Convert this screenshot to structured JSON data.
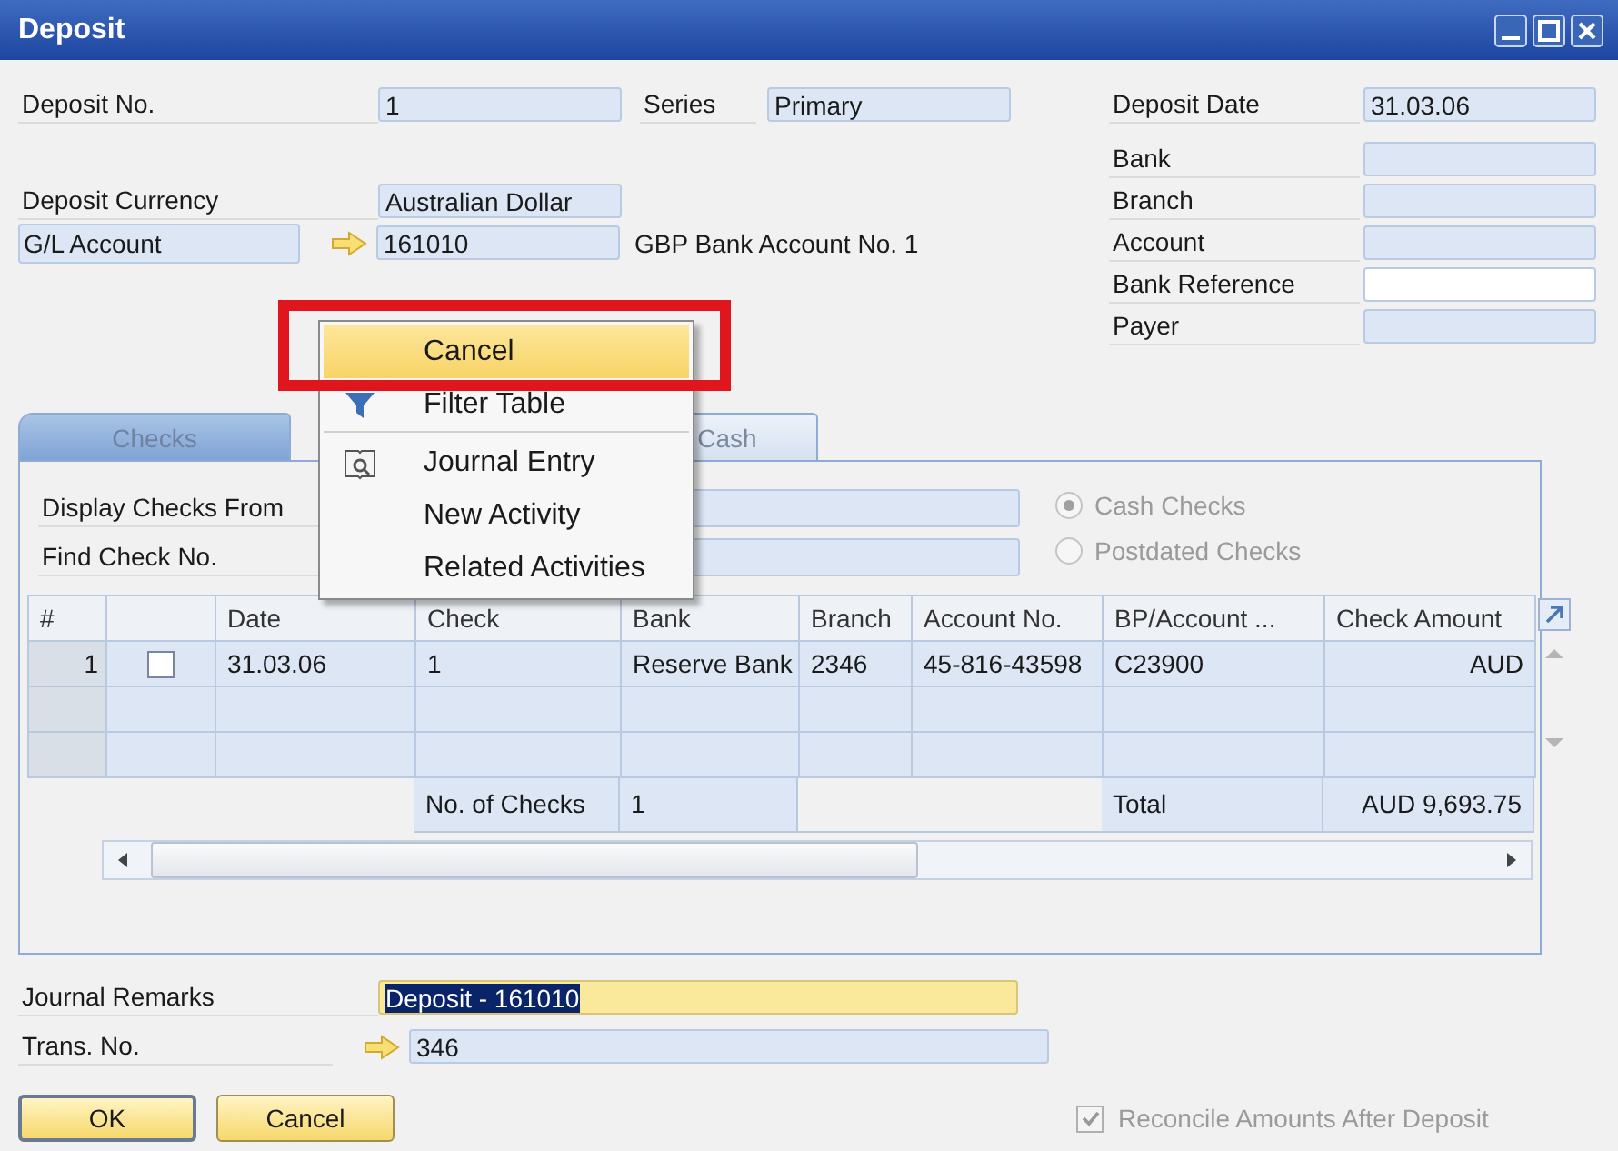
{
  "window": {
    "title": "Deposit"
  },
  "header": {
    "left": [
      {
        "label": "Deposit No.",
        "value": "1",
        "second_label": "Series",
        "second_value": "Primary"
      },
      {
        "label": "Deposit Currency",
        "value": "Australian Dollar"
      },
      {
        "label": "G/L Account",
        "kind": "linked",
        "value": "161010",
        "note": "GBP Bank Account No. 1"
      }
    ],
    "right": [
      {
        "label": "Deposit Date",
        "value": "31.03.06",
        "editable": false
      },
      {
        "label": "Bank",
        "editable": false
      },
      {
        "label": "Branch",
        "editable": false
      },
      {
        "label": "Account",
        "editable": false
      },
      {
        "label": "Bank Reference",
        "editable": true
      },
      {
        "label": "Payer",
        "editable": false
      }
    ]
  },
  "tabs": [
    {
      "label": "Checks",
      "selected": true
    },
    {
      "label": "Cash",
      "selected": false
    }
  ],
  "filters": [
    {
      "label": "Display Checks From"
    },
    {
      "label": "Find Check No."
    }
  ],
  "radios": [
    {
      "label": "Cash Checks",
      "selected": true,
      "disabled": true
    },
    {
      "label": "Postdated Checks",
      "selected": false,
      "disabled": true
    }
  ],
  "table": {
    "columns": [
      "#",
      "",
      "Date",
      "Check",
      "Bank",
      "Branch",
      "Account No.",
      "BP/Account ...",
      "Check Amount"
    ],
    "rows": [
      {
        "cells": [
          "1",
          {
            "kind": "checkbox",
            "checked": false
          },
          "31.03.06",
          "1",
          "Reserve Bank",
          "2346",
          "45-816-43598",
          "C23900",
          "AUD"
        ]
      }
    ],
    "footer": {
      "count_label": "No. of Checks",
      "count": "1",
      "total_label": "Total",
      "total": "AUD 9,693.75"
    }
  },
  "journal_remarks": {
    "label": "Journal Remarks",
    "value": "Deposit - 161010",
    "selected": true
  },
  "trans_no": {
    "label": "Trans. No.",
    "value": "346"
  },
  "buttons": [
    {
      "label": "OK",
      "default": true
    },
    {
      "label": "Cancel",
      "default": false
    }
  ],
  "reconcile": {
    "label": "Reconcile Amounts After Deposit",
    "checked": true,
    "disabled": true
  },
  "context_menu": {
    "items": [
      {
        "label": "Cancel",
        "kind": "text",
        "highlighted": true,
        "separator_after": false
      },
      {
        "label": "Filter Table",
        "kind": "filter",
        "highlighted": false,
        "separator_after": true
      },
      {
        "label": "Journal Entry",
        "kind": "journal",
        "highlighted": false,
        "separator_after": false
      },
      {
        "label": "New Activity",
        "kind": "text",
        "highlighted": false,
        "separator_after": false
      },
      {
        "label": "Related Activities",
        "kind": "text",
        "highlighted": false,
        "separator_after": false
      }
    ]
  },
  "highlight_frame": {
    "shown": true
  }
}
